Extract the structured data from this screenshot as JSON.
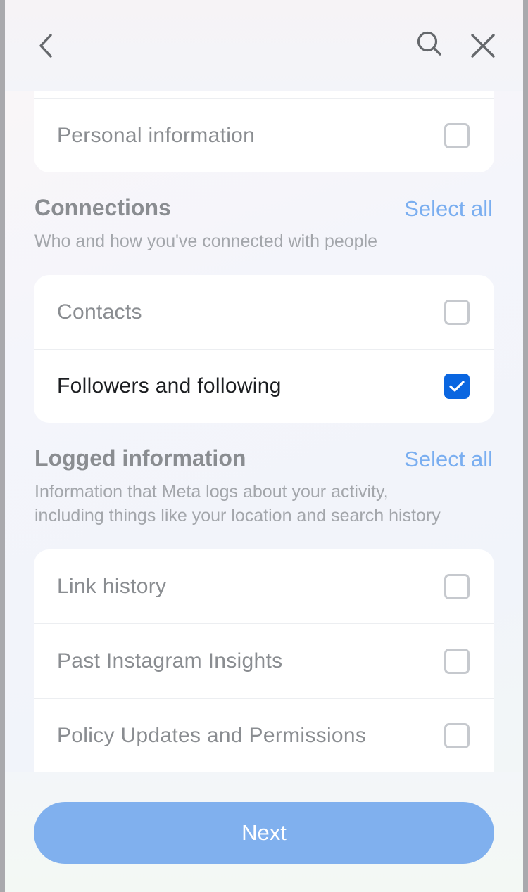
{
  "header": {
    "back_icon": "chevron-left-icon",
    "search_icon": "search-icon",
    "close_icon": "close-icon"
  },
  "personal_card": {
    "items": [
      {
        "label": "Personal information",
        "checked": false
      }
    ]
  },
  "connections": {
    "title": "Connections",
    "select_all": "Select all",
    "description": "Who and how you've connected with people",
    "items": [
      {
        "label": "Contacts",
        "checked": false
      },
      {
        "label": "Followers and following",
        "checked": true
      }
    ]
  },
  "logged": {
    "title": "Logged information",
    "select_all": "Select all",
    "description_line1": "Information that Meta logs about your activity,",
    "description_line2": "including things like your location and search history",
    "items": [
      {
        "label": "Link history",
        "checked": false
      },
      {
        "label": "Past Instagram Insights",
        "checked": false
      },
      {
        "label": "Policy Updates and Permissions",
        "checked": false
      }
    ]
  },
  "footer": {
    "next_label": "Next"
  },
  "colors": {
    "accent": "#0a66e0",
    "link": "#7aaef0",
    "button_disabled": "#80b0ee"
  }
}
